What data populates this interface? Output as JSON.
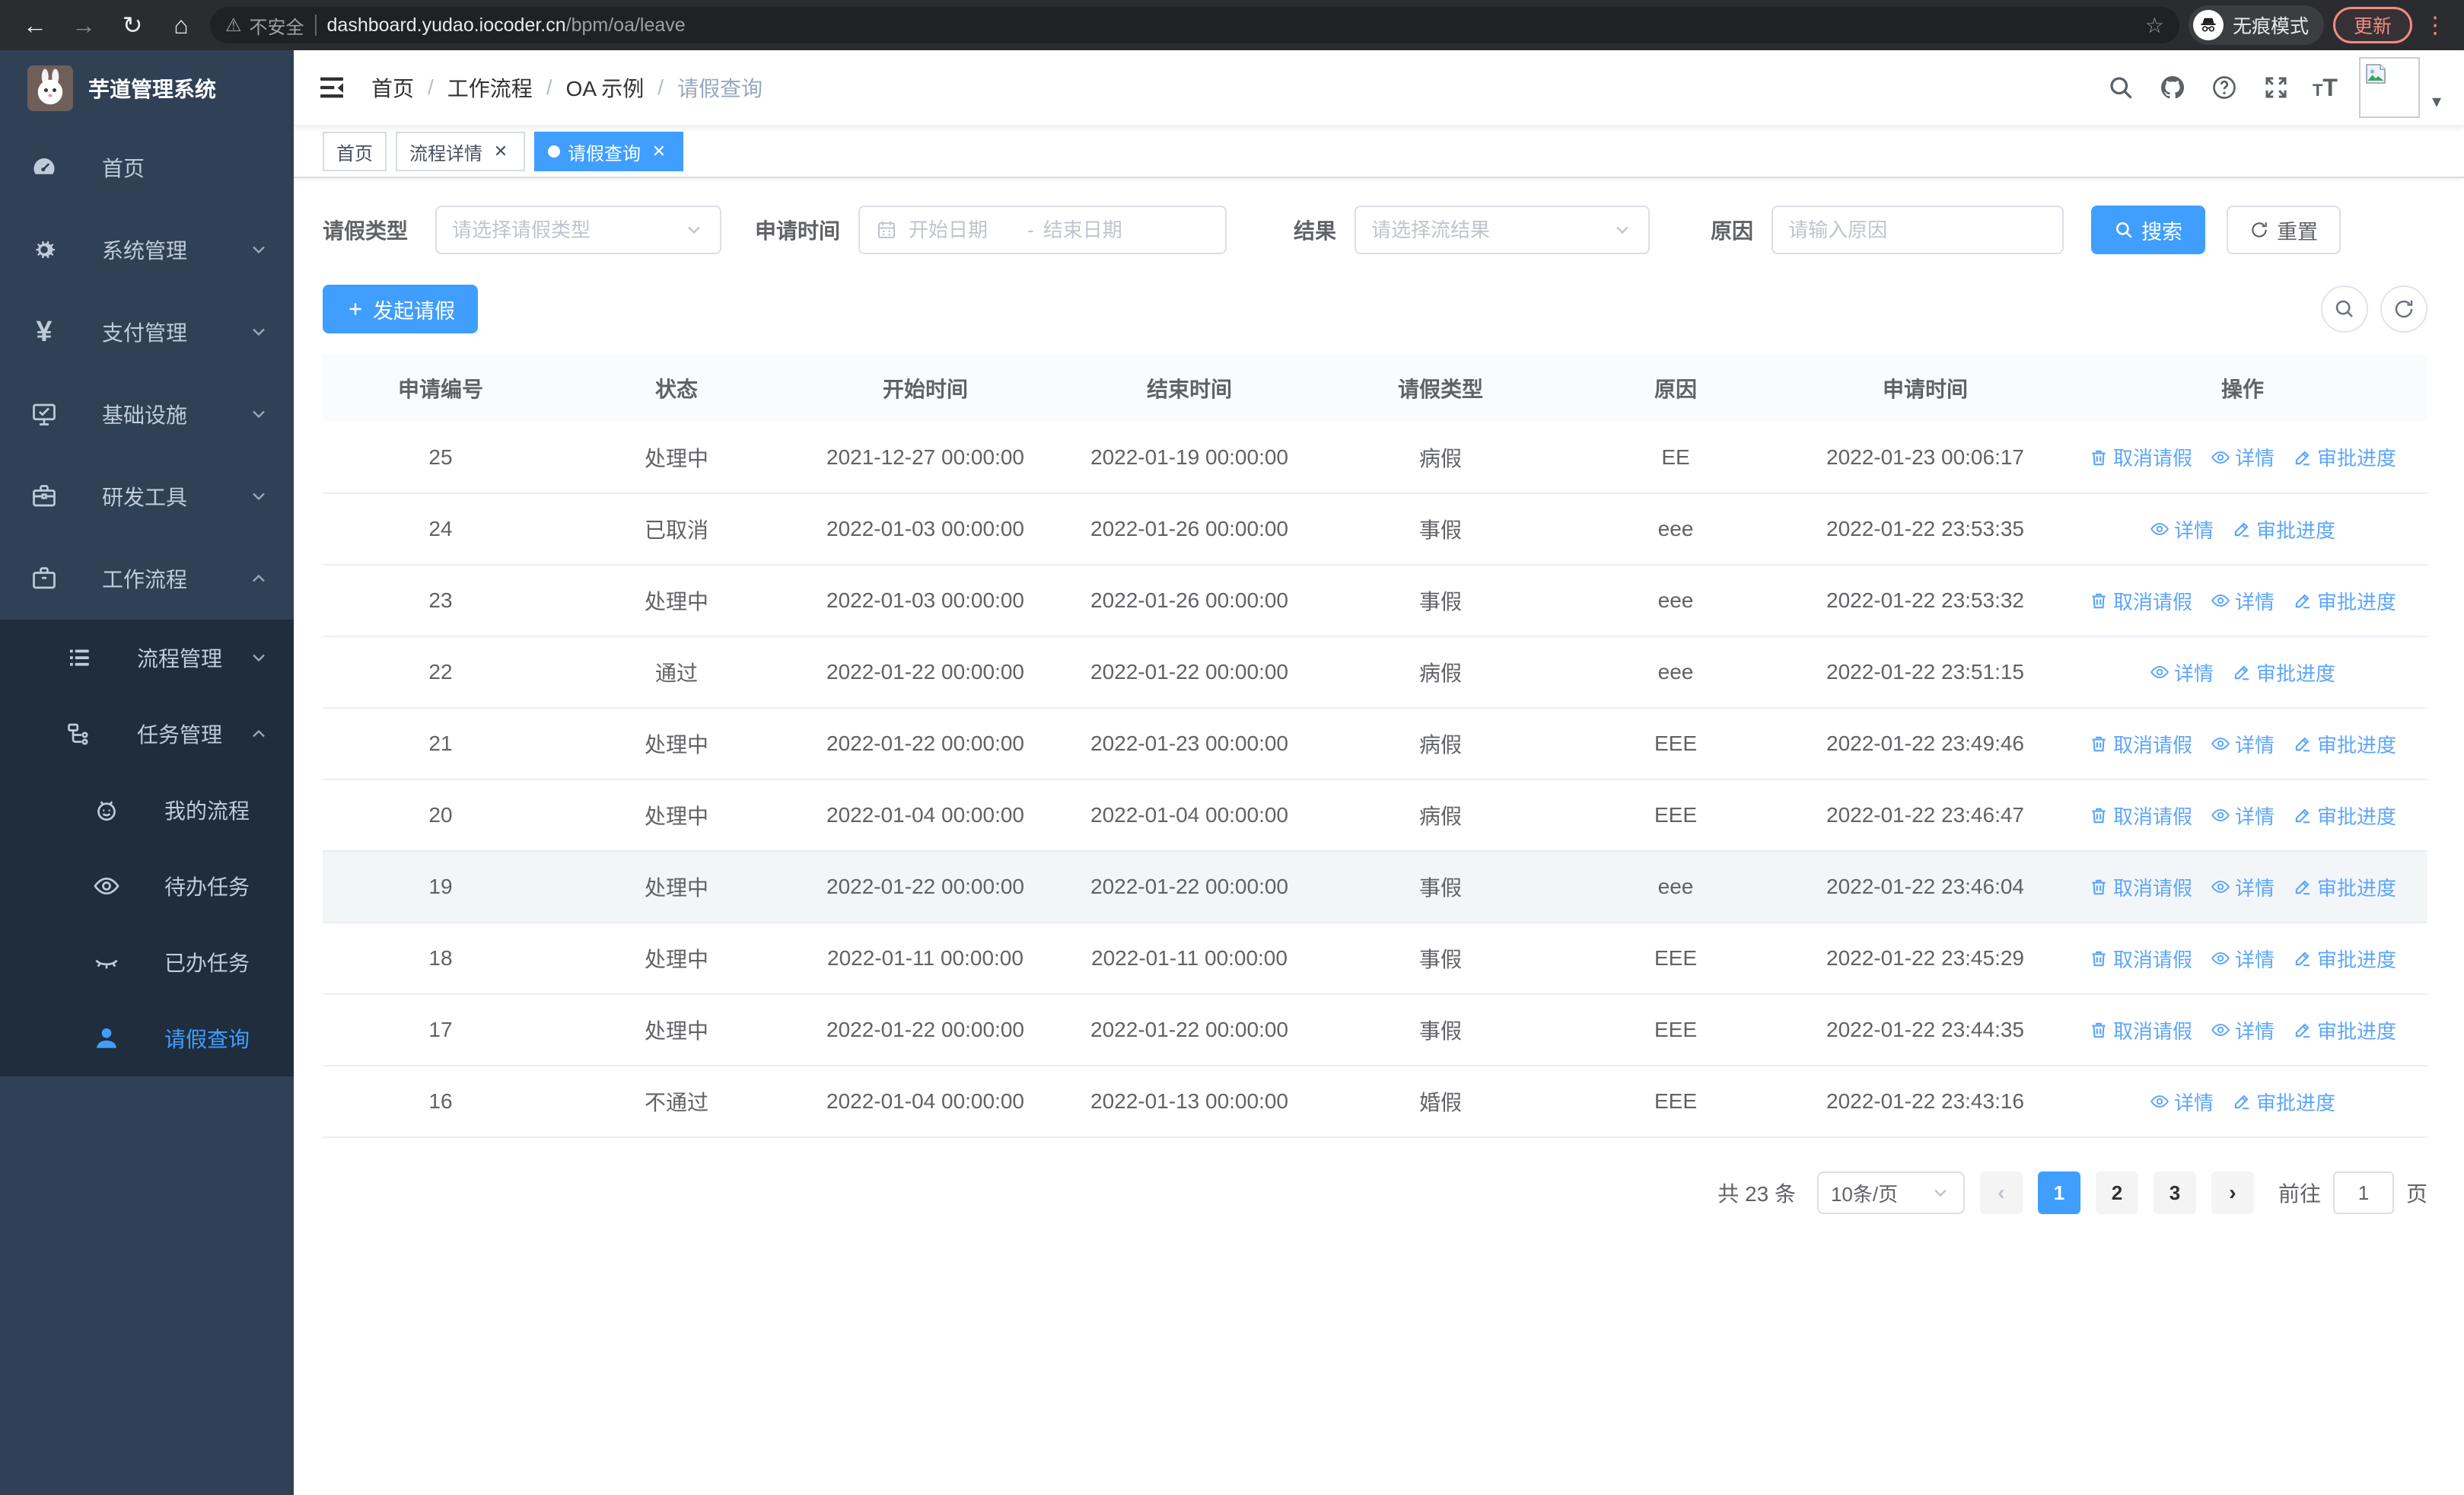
{
  "colors": {
    "primary": "#409eff",
    "link": "#5da6fb",
    "sidebar_bg": "#304156",
    "sidebar_submenu_bg": "#1f2d3d",
    "sidebar_text": "#bfcbd9",
    "update_accent": "#f28b82",
    "table_header_bg": "#fafbfc",
    "row_highlight_bg": "#f3f6f9"
  },
  "browser": {
    "security_label": "不安全",
    "url_domain": "dashboard.yudao.iocoder.cn",
    "url_path": "/bpm/oa/leave",
    "incognito_label": "无痕模式",
    "update_label": "更新"
  },
  "sidebar": {
    "title": "芋道管理系统",
    "items": [
      {
        "label": "首页",
        "icon": "dashboard-icon",
        "level": 1
      },
      {
        "label": "系统管理",
        "icon": "gear-icon",
        "level": 1,
        "arrow": "down"
      },
      {
        "label": "支付管理",
        "icon": "yen-icon",
        "level": 1,
        "arrow": "down"
      },
      {
        "label": "基础设施",
        "icon": "monitor-icon",
        "level": 1,
        "arrow": "down"
      },
      {
        "label": "研发工具",
        "icon": "toolbox-icon",
        "level": 1,
        "arrow": "down"
      },
      {
        "label": "工作流程",
        "icon": "briefcase-icon",
        "level": 1,
        "arrow": "up"
      },
      {
        "label": "流程管理",
        "icon": "list-icon",
        "level": 2,
        "arrow": "down",
        "sub": true
      },
      {
        "label": "任务管理",
        "icon": "flow-icon",
        "level": 2,
        "arrow": "up",
        "sub": true
      },
      {
        "label": "我的流程",
        "icon": "face-icon",
        "level": 3,
        "sub": true
      },
      {
        "label": "待办任务",
        "icon": "eye-icon",
        "level": 3,
        "sub": true
      },
      {
        "label": "已办任务",
        "icon": "eye-closed-icon",
        "level": 3,
        "sub": true
      },
      {
        "label": "请假查询",
        "icon": "user-icon",
        "level": 3,
        "sub": true,
        "active": true
      }
    ]
  },
  "header": {
    "breadcrumb": [
      "首页",
      "工作流程",
      "OA 示例",
      "请假查询"
    ]
  },
  "tabs": [
    {
      "label": "首页",
      "closable": false,
      "active": false
    },
    {
      "label": "流程详情",
      "closable": true,
      "active": false
    },
    {
      "label": "请假查询",
      "closable": true,
      "active": true
    }
  ],
  "filters": {
    "leave_type_label": "请假类型",
    "leave_type_placeholder": "请选择请假类型",
    "apply_time_label": "申请时间",
    "start_date_placeholder": "开始日期",
    "range_separator": "-",
    "end_date_placeholder": "结束日期",
    "result_label": "结果",
    "result_placeholder": "请选择流结果",
    "reason_label": "原因",
    "reason_placeholder": "请输入原因",
    "search_label": "搜索",
    "reset_label": "重置"
  },
  "toolbar": {
    "create_label": "发起请假"
  },
  "table": {
    "headers": [
      "申请编号",
      "状态",
      "开始时间",
      "结束时间",
      "请假类型",
      "原因",
      "申请时间",
      "操作"
    ],
    "action_labels": {
      "cancel": "取消请假",
      "detail": "详情",
      "progress": "审批进度"
    },
    "rows": [
      {
        "id": "25",
        "status": "处理中",
        "start": "2021-12-27 00:00:00",
        "end": "2022-01-19 00:00:00",
        "type": "病假",
        "reason": "EE",
        "apply": "2022-01-23 00:06:17",
        "actions": [
          "cancel",
          "detail",
          "progress"
        ],
        "highlighted": false
      },
      {
        "id": "24",
        "status": "已取消",
        "start": "2022-01-03 00:00:00",
        "end": "2022-01-26 00:00:00",
        "type": "事假",
        "reason": "eee",
        "apply": "2022-01-22 23:53:35",
        "actions": [
          "detail",
          "progress"
        ],
        "highlighted": false
      },
      {
        "id": "23",
        "status": "处理中",
        "start": "2022-01-03 00:00:00",
        "end": "2022-01-26 00:00:00",
        "type": "事假",
        "reason": "eee",
        "apply": "2022-01-22 23:53:32",
        "actions": [
          "cancel",
          "detail",
          "progress"
        ],
        "highlighted": false
      },
      {
        "id": "22",
        "status": "通过",
        "start": "2022-01-22 00:00:00",
        "end": "2022-01-22 00:00:00",
        "type": "病假",
        "reason": "eee",
        "apply": "2022-01-22 23:51:15",
        "actions": [
          "detail",
          "progress"
        ],
        "highlighted": false
      },
      {
        "id": "21",
        "status": "处理中",
        "start": "2022-01-22 00:00:00",
        "end": "2022-01-23 00:00:00",
        "type": "病假",
        "reason": "EEE",
        "apply": "2022-01-22 23:49:46",
        "actions": [
          "cancel",
          "detail",
          "progress"
        ],
        "highlighted": false
      },
      {
        "id": "20",
        "status": "处理中",
        "start": "2022-01-04 00:00:00",
        "end": "2022-01-04 00:00:00",
        "type": "病假",
        "reason": "EEE",
        "apply": "2022-01-22 23:46:47",
        "actions": [
          "cancel",
          "detail",
          "progress"
        ],
        "highlighted": false
      },
      {
        "id": "19",
        "status": "处理中",
        "start": "2022-01-22 00:00:00",
        "end": "2022-01-22 00:00:00",
        "type": "事假",
        "reason": "eee",
        "apply": "2022-01-22 23:46:04",
        "actions": [
          "cancel",
          "detail",
          "progress"
        ],
        "highlighted": true
      },
      {
        "id": "18",
        "status": "处理中",
        "start": "2022-01-11 00:00:00",
        "end": "2022-01-11 00:00:00",
        "type": "事假",
        "reason": "EEE",
        "apply": "2022-01-22 23:45:29",
        "actions": [
          "cancel",
          "detail",
          "progress"
        ],
        "highlighted": false
      },
      {
        "id": "17",
        "status": "处理中",
        "start": "2022-01-22 00:00:00",
        "end": "2022-01-22 00:00:00",
        "type": "事假",
        "reason": "EEE",
        "apply": "2022-01-22 23:44:35",
        "actions": [
          "cancel",
          "detail",
          "progress"
        ],
        "highlighted": false
      },
      {
        "id": "16",
        "status": "不通过",
        "start": "2022-01-04 00:00:00",
        "end": "2022-01-13 00:00:00",
        "type": "婚假",
        "reason": "EEE",
        "apply": "2022-01-22 23:43:16",
        "actions": [
          "detail",
          "progress"
        ],
        "highlighted": false
      }
    ]
  },
  "pagination": {
    "total_label": "共 23 条",
    "page_size_label": "10条/页",
    "pages": [
      "1",
      "2",
      "3"
    ],
    "current_page": "1",
    "goto_label": "前往",
    "page_suffix": "页",
    "goto_value": "1"
  }
}
